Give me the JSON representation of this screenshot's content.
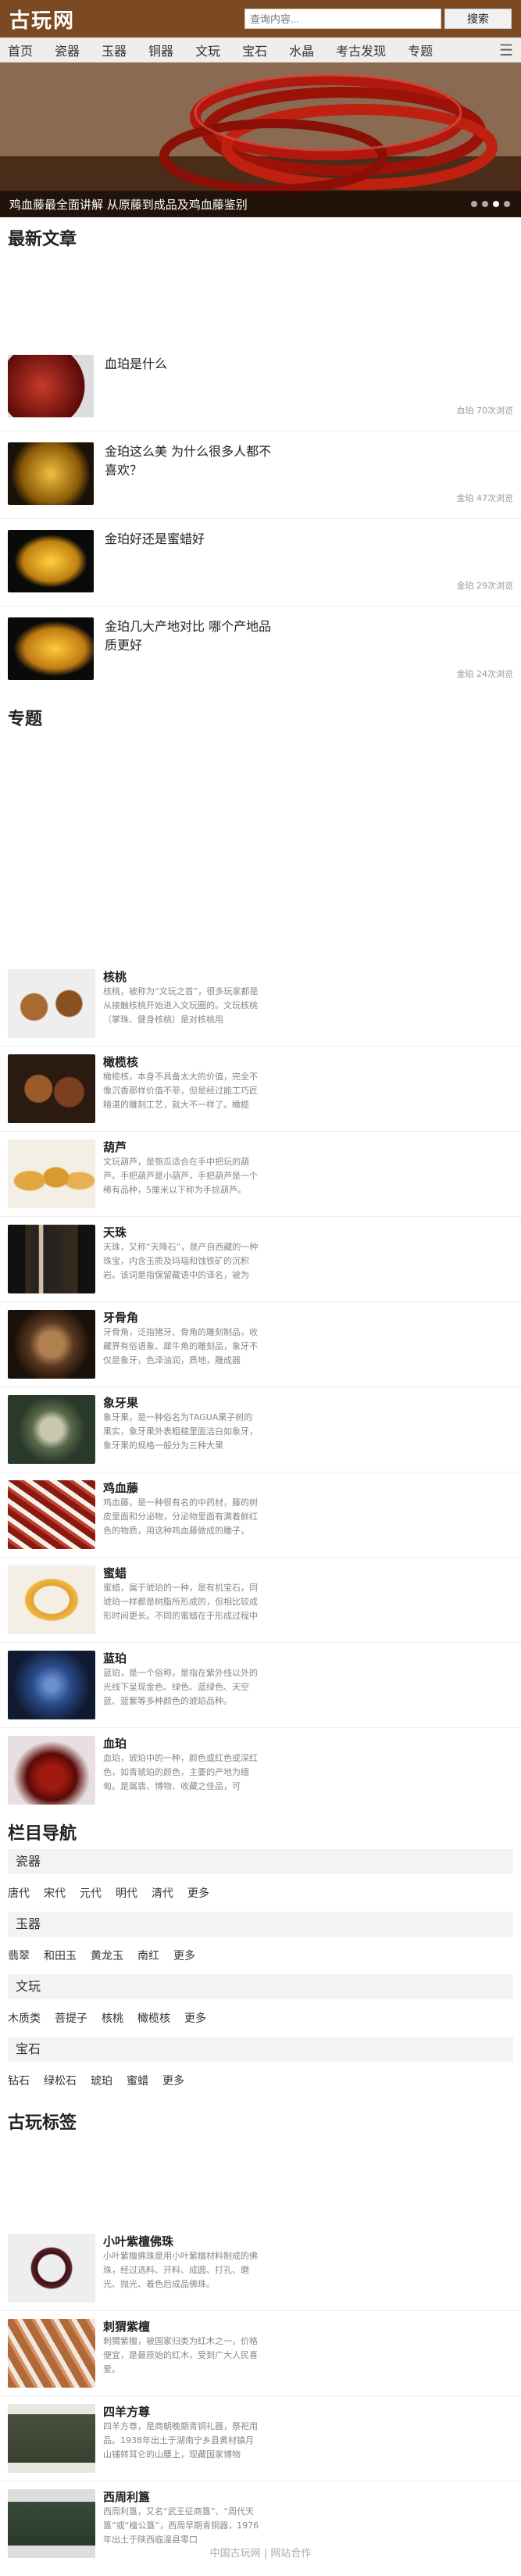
{
  "header": {
    "logo": "古玩网",
    "search_placeholder": "查询内容...",
    "search_button": "搜索"
  },
  "nav": [
    "首页",
    "瓷器",
    "玉器",
    "铜器",
    "文玩",
    "宝石",
    "水晶",
    "考古发现",
    "专题"
  ],
  "banner": {
    "caption": "鸡血藤最全面讲解 从原藤到成品及鸡血藤鉴别"
  },
  "latest": {
    "title": "最新文章",
    "items": [
      {
        "title": "血珀是什么",
        "meta": "血珀 70次浏览",
        "thumb_color": "#7a1a14"
      },
      {
        "title": "金珀这么美 为什么很多人都不喜欢？",
        "meta": "金珀 47次浏览",
        "thumb_color": "#b8860b"
      },
      {
        "title": "金珀好还是蜜蜡好",
        "meta": "金珀 29次浏览",
        "thumb_color": "#d4a017"
      },
      {
        "title": "金珀几大产地对比 哪个产地品质更好",
        "meta": "金珀 24次浏览",
        "thumb_color": "#c68a10"
      }
    ]
  },
  "topics": {
    "title": "专题",
    "items": [
      {
        "name": "核桃",
        "desc": "核桃，被称为“文玩之首”，很多玩家都是从接触核桃开始进入文玩圈的。文玩核桃（掌珠、健身核桃）是对核桃用",
        "color": "#8a5a2b"
      },
      {
        "name": "橄榄核",
        "desc": "橄榄核，本身不具备太大的价值，完全不像沉香那样价值不菲，但是经过能工巧匠精湛的雕刻工艺，就大不一样了。橄榄",
        "color": "#7a4a2a"
      },
      {
        "name": "葫芦",
        "desc": "文玩葫芦，是匏瓜适合在手中把玩的葫芦。手把葫芦是小葫芦，手把葫芦是一个稀有品种，5厘米以下称为手捻葫芦。",
        "color": "#d9a441"
      },
      {
        "name": "天珠",
        "desc": "天珠，又称“天降石”，是产自西藏的一种珠宝，内含玉质及玛瑙和蚀铁矿的沉积岩。该词是指保留藏语中的译名，被为",
        "color": "#222"
      },
      {
        "name": "牙骨角",
        "desc": "牙骨角，泛指猪牙、骨角的雕刻制品，收藏界有俗语象、犀牛角的雕刻品，象牙不仅是象牙，色泽油润，质地，雕成器",
        "color": "#5a3a20"
      },
      {
        "name": "象牙果",
        "desc": "象牙果，是一种俗名为TAGUA果子树的果实，象牙果外表粗糙里面洁白如象牙，象牙果的规格一般分为三种大果",
        "color": "#4a5a3a"
      },
      {
        "name": "鸡血藤",
        "desc": "鸡血藤，是一种很有名的中药材，藤的树皮里面和分泌物，分泌物里面有满着鲜红色的物质，用这种鸡血藤做成的雕子，",
        "color": "#8a1a10"
      },
      {
        "name": "蜜蜡",
        "desc": "蜜蜡，属于琥珀的一种，是有机宝石，同琥珀一样都是树脂所形成的，但相比较成形时间更长。不同的蜜蜡在于形成过程中",
        "color": "#e0a030"
      },
      {
        "name": "蓝珀",
        "desc": "蓝珀，是一个俗称，是指在紫外线以外的光线下呈现金色、绿色、蓝绿色、天空蓝、蓝紫等多种颜色的琥珀品种。",
        "color": "#2a4a8a"
      },
      {
        "name": "血珀",
        "desc": "血珀，琥珀中的一种，颜色或红色或深红色，如青琥珀的颜色，主要的产地为缅甸。是属翡、博物、收藏之佳品，可",
        "color": "#6a0a0a"
      }
    ]
  },
  "column_nav": {
    "title": "栏目导航",
    "groups": [
      {
        "head": "瓷器",
        "links": [
          "唐代",
          "宋代",
          "元代",
          "明代",
          "清代",
          "更多"
        ]
      },
      {
        "head": "玉器",
        "links": [
          "翡翠",
          "和田玉",
          "黄龙玉",
          "南红",
          "更多"
        ]
      },
      {
        "head": "文玩",
        "links": [
          "木质类",
          "菩提子",
          "核桃",
          "橄榄核",
          "更多"
        ]
      },
      {
        "head": "宝石",
        "links": [
          "钻石",
          "绿松石",
          "琥珀",
          "蜜蜡",
          "更多"
        ]
      }
    ]
  },
  "tags": {
    "title": "古玩标签",
    "items": [
      {
        "name": "小叶紫檀佛珠",
        "desc": "小叶紫檀佛珠是用小叶紫檀材料制成的佛珠，经过选料、开料、成圆、打孔、磨光、抛光、着色后成品佛珠。",
        "color": "#4a1a20"
      },
      {
        "name": "刺猬紫檀",
        "desc": "刺猬紫檀，被国家归类为红木之一，价格便宜，是最原始的红木，受到广大人民喜爱。",
        "color": "#a0603a"
      },
      {
        "name": "四羊方尊",
        "desc": "四羊方尊，是商朝晚期青铜礼器，祭祀用品。1938年出土于湖南宁乡县黄材镇月山铺转耳仑的山腰上，现藏国家博物",
        "color": "#4a5040"
      },
      {
        "name": "西周利簋",
        "desc": "西周利簋，又名“武王征商簋”、“周代天簋”或“檀公簋”，西周早期青铜器，1976年出土于陕西临潼县零口",
        "color": "#3a4a3a"
      }
    ]
  },
  "footer": "中国古玩网 | 网站合作"
}
